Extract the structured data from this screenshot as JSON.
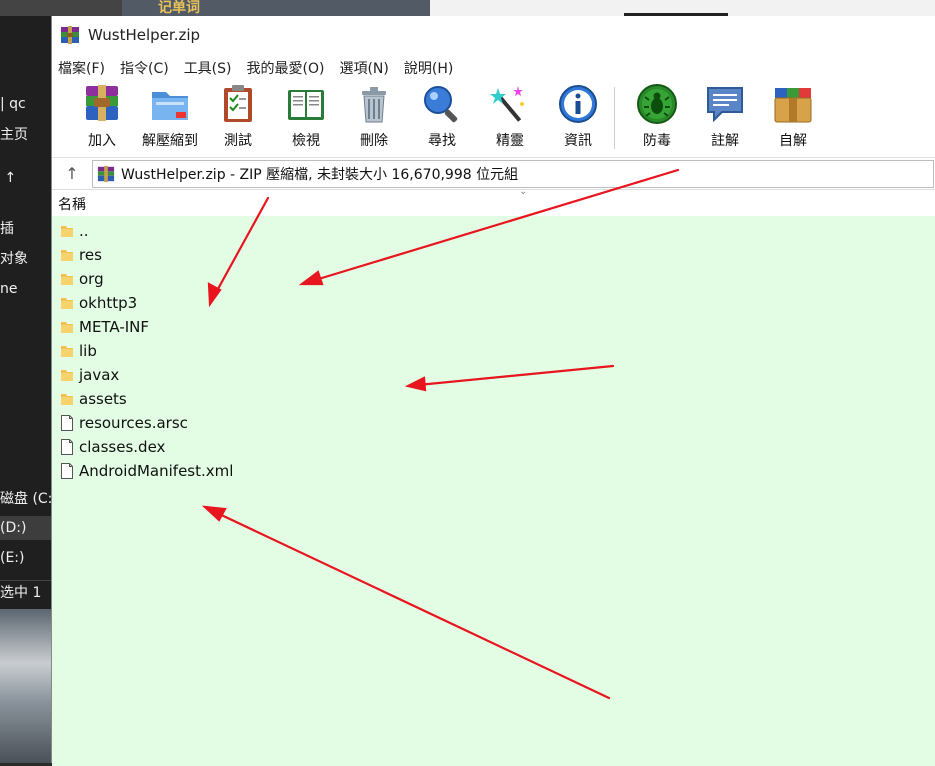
{
  "background": {
    "title_fragment": "记单词",
    "explorer_top": "| qc",
    "explorer_rows": [
      "主页",
      "",
      "",
      "插",
      "对象",
      "ne"
    ],
    "drive_c": "磁盘 (C:",
    "drive_d": "(D:)",
    "drive_e": "(E:)",
    "status": "选中 1"
  },
  "window": {
    "title": "WustHelper.zip",
    "menu": [
      "檔案(F)",
      "指令(C)",
      "工具(S)",
      "我的最愛(O)",
      "選項(N)",
      "說明(H)"
    ],
    "toolbar": [
      {
        "label": "加入",
        "icon": "add-archive-icon"
      },
      {
        "label": "解壓縮到",
        "icon": "extract-folder-icon"
      },
      {
        "label": "測試",
        "icon": "test-clipboard-icon"
      },
      {
        "label": "檢視",
        "icon": "view-book-icon"
      },
      {
        "label": "刪除",
        "icon": "trash-icon"
      },
      {
        "label": "尋找",
        "icon": "magnifier-icon"
      },
      {
        "label": "精靈",
        "icon": "wizard-wand-icon"
      },
      {
        "label": "資訊",
        "icon": "info-icon"
      },
      {
        "label": "防毒",
        "icon": "virus-scan-icon"
      },
      {
        "label": "註解",
        "icon": "comment-icon"
      },
      {
        "label": "自解",
        "icon": "sfx-archive-icon"
      }
    ],
    "address": "WustHelper.zip - ZIP 壓縮檔, 未封裝大小 16,670,998 位元組",
    "column_name": "名稱",
    "files": [
      {
        "name": "..",
        "type": "folder"
      },
      {
        "name": "res",
        "type": "folder"
      },
      {
        "name": "org",
        "type": "folder"
      },
      {
        "name": "okhttp3",
        "type": "folder"
      },
      {
        "name": "META-INF",
        "type": "folder"
      },
      {
        "name": "lib",
        "type": "folder"
      },
      {
        "name": "javax",
        "type": "folder"
      },
      {
        "name": "assets",
        "type": "folder"
      },
      {
        "name": "resources.arsc",
        "type": "file"
      },
      {
        "name": "classes.dex",
        "type": "file"
      },
      {
        "name": "AndroidManifest.xml",
        "type": "file"
      }
    ],
    "colors": {
      "list_background": "#e3fde5",
      "annotation_arrow": "#e8141e"
    }
  }
}
